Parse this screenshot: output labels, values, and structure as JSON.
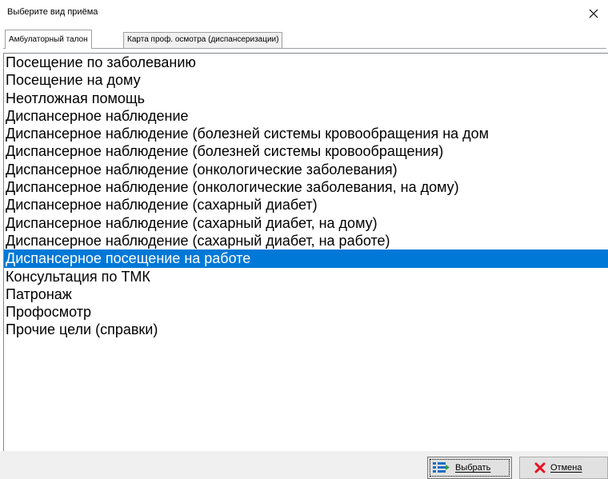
{
  "window": {
    "title": "Выберите вид приёма"
  },
  "tabs": [
    {
      "label": "Амбулаторный талон",
      "active": true
    },
    {
      "label": "Карта проф. осмотра (диспансеризации)",
      "active": false
    }
  ],
  "list": {
    "selected_index": 11,
    "items": [
      "Посещение по заболеванию",
      "Посещение на дому",
      "Неотложная помощь",
      "Диспансерное наблюдение",
      "Диспансерное наблюдение (болезней системы кровообращения на дом",
      "Диспансерное наблюдение (болезней системы кровообращения)",
      "Диспансерное наблюдение (онкологические заболевания)",
      "Диспансерное наблюдение (онкологические заболевания, на дому)",
      "Диспансерное наблюдение (сахарный диабет)",
      "Диспансерное наблюдение (сахарный диабет, на дому)",
      "Диспансерное наблюдение (сахарный диабет, на работе)",
      "Диспансерное посещение на работе",
      "Консультация по ТМК",
      "Патронаж",
      "Профосмотр",
      "Прочие цели (справки)"
    ]
  },
  "buttons": {
    "select_label": "Выбрать",
    "select_icon": "list-select-icon",
    "cancel_label": "Отмена",
    "cancel_icon": "red-x-icon"
  },
  "colors": {
    "selection": "#0078d7",
    "cancel_icon": "#e81123",
    "select_icon": "#1a6fc4"
  }
}
